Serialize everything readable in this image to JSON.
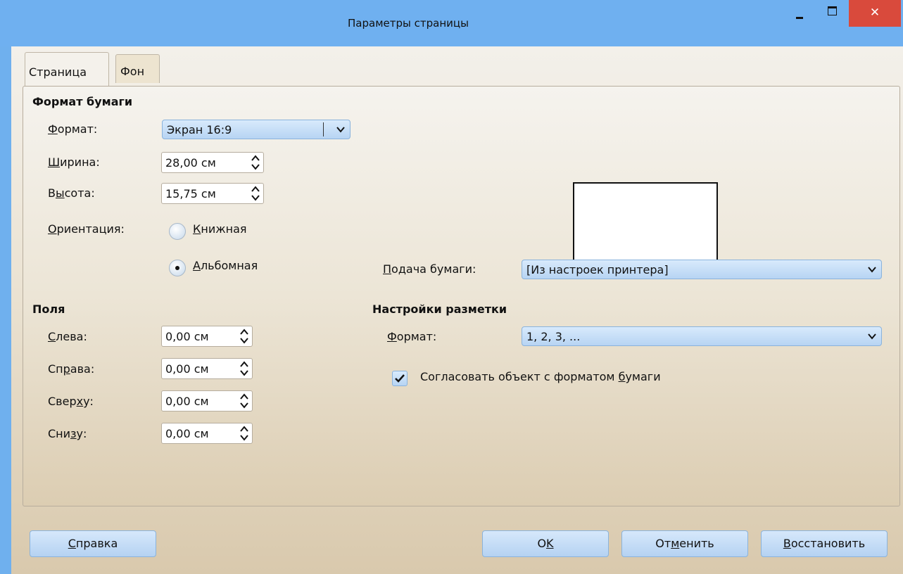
{
  "window": {
    "title": "Параметры страницы"
  },
  "tabs": [
    {
      "label": "Страница",
      "active": true
    },
    {
      "label": "Фон",
      "active": false
    }
  ],
  "paper_format": {
    "heading": "Формат бумаги",
    "format": {
      "label": "Формат:",
      "value": "Экран 16:9"
    },
    "width": {
      "label": "Ширина:",
      "value": "28,00 см"
    },
    "height": {
      "label": "Высота:",
      "value": "15,75 см"
    },
    "orientation": {
      "label": "Ориентация:",
      "portrait": "Книжная",
      "landscape": "Альбомная",
      "selected": "landscape"
    },
    "paper_tray": {
      "label": "Подача бумаги:",
      "value": "[Из настроек принтера]"
    }
  },
  "margins": {
    "heading": "Поля",
    "left": {
      "label": "Слева:",
      "value": "0,00 см"
    },
    "right": {
      "label": "Справа:",
      "value": "0,00 см"
    },
    "top": {
      "label": "Сверху:",
      "value": "0,00 см"
    },
    "bottom": {
      "label": "Снизу:",
      "value": "0,00 см"
    }
  },
  "layout_settings": {
    "heading": "Настройки разметки",
    "format": {
      "label": "Формат:",
      "value": "1, 2, 3, ..."
    },
    "fit_object": {
      "label": "Согласовать объект с форматом бумаги",
      "checked": true
    }
  },
  "buttons": {
    "help": "Справка",
    "ok": "OK",
    "cancel": "Отменить",
    "reset": "Восстановить"
  },
  "colors": {
    "titlebar": "#6fb0f0",
    "close": "#d94a3c",
    "button": "#c6ddf6"
  }
}
